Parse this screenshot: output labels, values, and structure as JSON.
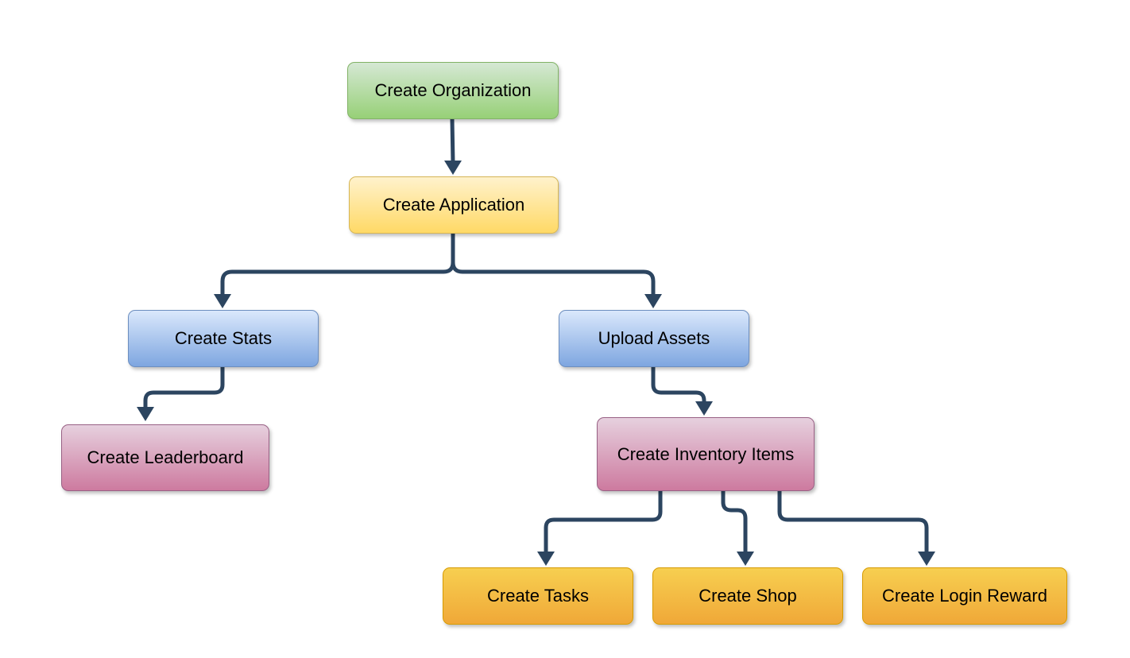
{
  "diagram": {
    "nodes": [
      {
        "id": "org",
        "label": "Create Organization",
        "color": "green"
      },
      {
        "id": "app",
        "label": "Create Application",
        "color": "yellow"
      },
      {
        "id": "stats",
        "label": "Create Stats",
        "color": "blue"
      },
      {
        "id": "assets",
        "label": "Upload Assets",
        "color": "blue"
      },
      {
        "id": "leaderboard",
        "label": "Create Leaderboard",
        "color": "pink"
      },
      {
        "id": "inventory",
        "label": "Create Inventory Items",
        "color": "pink"
      },
      {
        "id": "tasks",
        "label": "Create Tasks",
        "color": "orange"
      },
      {
        "id": "shop",
        "label": "Create Shop",
        "color": "orange"
      },
      {
        "id": "login",
        "label": "Create Login Reward",
        "color": "orange"
      }
    ],
    "edges": [
      {
        "from": "org",
        "to": "app"
      },
      {
        "from": "app",
        "to": "stats"
      },
      {
        "from": "app",
        "to": "assets"
      },
      {
        "from": "stats",
        "to": "leaderboard"
      },
      {
        "from": "assets",
        "to": "inventory"
      },
      {
        "from": "inventory",
        "to": "tasks"
      },
      {
        "from": "inventory",
        "to": "shop"
      },
      {
        "from": "inventory",
        "to": "login"
      }
    ],
    "edge_color": "#2c4560"
  }
}
